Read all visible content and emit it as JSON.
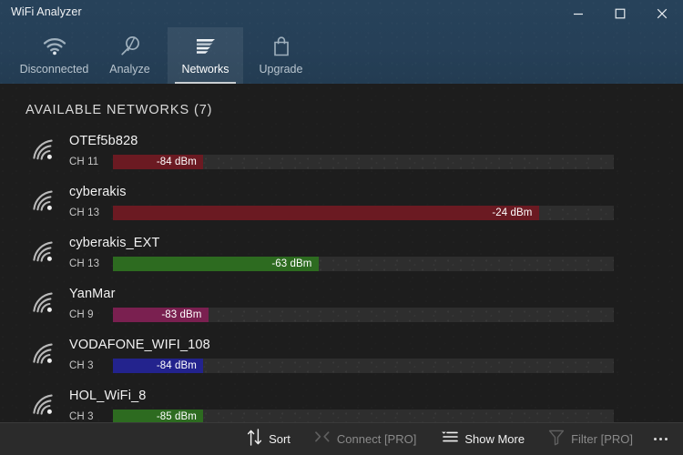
{
  "window": {
    "title": "WiFi Analyzer",
    "controls": [
      {
        "name": "minimize",
        "glyph": "minimize-icon"
      },
      {
        "name": "maximize",
        "glyph": "maximize-icon"
      },
      {
        "name": "close",
        "glyph": "close-icon"
      }
    ]
  },
  "tabs": [
    {
      "label": "Disconnected",
      "icon": "wifi-signal-icon",
      "active": false
    },
    {
      "label": "Analyze",
      "icon": "magnifier-icon",
      "active": false
    },
    {
      "label": "Networks",
      "icon": "bar-list-icon",
      "active": true
    },
    {
      "label": "Upgrade",
      "icon": "shopping-bag-icon",
      "active": false
    }
  ],
  "main": {
    "section_title": "AVAILABLE NETWORKS (7)",
    "networks": [
      {
        "ssid": "OTEf5b828",
        "channel": "CH 11",
        "signal": "-84 dBm",
        "fill_pct": 18,
        "color": "#6b1a22",
        "icon": "wifi-arc-icon"
      },
      {
        "ssid": "cyberakis",
        "channel": "CH 13",
        "signal": "-24 dBm",
        "fill_pct": 85,
        "color": "#6b1a22",
        "icon": "wifi-arc-icon"
      },
      {
        "ssid": "cyberakis_EXT",
        "channel": "CH 13",
        "signal": "-63 dBm",
        "fill_pct": 41,
        "color": "#2d6b20",
        "icon": "wifi-arc-icon"
      },
      {
        "ssid": "YanMar",
        "channel": "CH 9",
        "signal": "-83 dBm",
        "fill_pct": 19,
        "color": "#7a2050",
        "icon": "wifi-arc-icon"
      },
      {
        "ssid": "VODAFONE_WIFI_108",
        "channel": "CH 3",
        "signal": "-84 dBm",
        "fill_pct": 18,
        "color": "#23238d",
        "icon": "wifi-arc-icon"
      },
      {
        "ssid": "HOL_WiFi_8",
        "channel": "CH 3",
        "signal": "-85 dBm",
        "fill_pct": 18,
        "color": "#2d6b20",
        "icon": "wifi-arc-icon"
      }
    ]
  },
  "bottombar": {
    "buttons": [
      {
        "label": "Sort",
        "icon": "sort-arrows-icon",
        "disabled": false
      },
      {
        "label": "Connect [PRO]",
        "icon": "connect-plug-icon",
        "disabled": true
      },
      {
        "label": "Show More",
        "icon": "list-caret-icon",
        "disabled": false
      },
      {
        "label": "Filter [PRO]",
        "icon": "funnel-icon",
        "disabled": true
      }
    ],
    "overflow": "more-dots-icon"
  },
  "colors": {
    "header_bg": "#27425a",
    "content_bg": "#1d1d1d",
    "bottom_bg": "#2b2b2b",
    "track": "#2e2e2e",
    "red": "#6b1a22",
    "green": "#2d6b20",
    "magenta": "#7a2050",
    "blue": "#23238d"
  }
}
